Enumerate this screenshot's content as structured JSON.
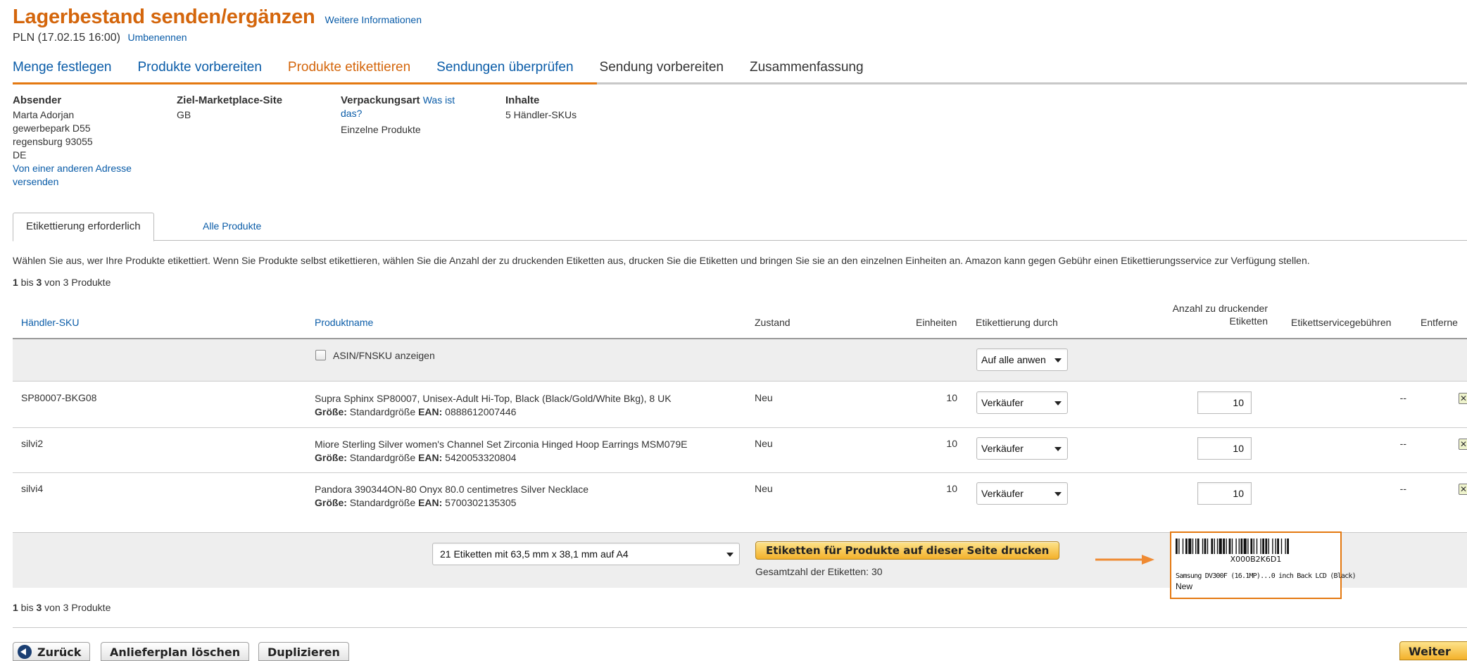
{
  "header": {
    "title": "Lagerbestand senden/ergänzen",
    "more_info": "Weitere Informationen",
    "plan_name": "PLN (17.02.15 16:00)",
    "rename": "Umbenennen"
  },
  "steps": [
    {
      "label": "Menge festlegen",
      "state": "done"
    },
    {
      "label": "Produkte vorbereiten",
      "state": "done"
    },
    {
      "label": "Produkte etikettieren",
      "state": "active"
    },
    {
      "label": "Sendungen überprüfen",
      "state": "done"
    },
    {
      "label": "Sendung vorbereiten",
      "state": "future"
    },
    {
      "label": "Zusammenfassung",
      "state": "future"
    }
  ],
  "shipment_info": {
    "sender_header": "Absender",
    "sender_lines": [
      "Marta Adorjan",
      "gewerbepark D55",
      "regensburg 93055",
      "DE"
    ],
    "sender_link_1": "Von einer anderen Adresse",
    "sender_link_2": "versenden",
    "marketplace_header": "Ziel-Marketplace-Site",
    "marketplace_value": "GB",
    "packaging_header": "Verpackungsart",
    "packaging_link_1": "Was ist",
    "packaging_link_2": "das?",
    "packaging_value": "Einzelne Produkte",
    "contents_header": "Inhalte",
    "contents_value": "5 Händler-SKUs"
  },
  "subtabs": {
    "required": "Etikettierung erforderlich",
    "all": "Alle Produkte"
  },
  "description": "Wählen Sie aus, wer Ihre Produkte etikettiert. Wenn Sie Produkte selbst etikettieren, wählen Sie die Anzahl der zu druckenden Etiketten aus, drucken Sie die Etiketten und bringen Sie sie an den einzelnen Einheiten an. Amazon kann gegen Gebühr einen Etikettierungsservice zur Verfügung stellen.",
  "range": {
    "from": "1",
    "bis": " bis ",
    "to": "3",
    "von": " von ",
    "total": "3",
    "suffix": " Produkte"
  },
  "table": {
    "headers": {
      "sku": "Händler-SKU",
      "name": "Produktname",
      "condition": "Zustand",
      "units": "Einheiten",
      "labeled_by": "Etikettierung durch",
      "labels_line1": "Anzahl zu druckender",
      "labels_line2": "Etiketten",
      "fees": "Etikettservicegebühren",
      "remove": "Entferne"
    },
    "filter": {
      "show_asin": "ASIN/FNSKU anzeigen",
      "apply_all": "Auf alle anwen"
    },
    "rows": [
      {
        "sku": "SP80007-BKG08",
        "name": "Supra Sphinx SP80007, Unisex-Adult Hi-Top, Black (Black/Gold/White Bkg), 8 UK",
        "size_label": "Größe:",
        "size": " Standardgröße ",
        "ean_label": "EAN:",
        "ean": " 0888612007446",
        "condition": "Neu",
        "units": "10",
        "labeled_by": "Verkäufer",
        "labels": "10",
        "fees": "--"
      },
      {
        "sku": "silvi2",
        "name": "Miore Sterling Silver women's Channel Set Zirconia Hinged Hoop Earrings MSM079E",
        "size_label": "Größe:",
        "size": " Standardgröße ",
        "ean_label": "EAN:",
        "ean": " 5420053320804",
        "condition": "Neu",
        "units": "10",
        "labeled_by": "Verkäufer",
        "labels": "10",
        "fees": "--"
      },
      {
        "sku": "silvi4",
        "name": "Pandora 390344ON-80 Onyx 80.0 centimetres Silver Necklace",
        "size_label": "Größe:",
        "size": " Standardgröße ",
        "ean_label": "EAN:",
        "ean": " 5700302135305",
        "condition": "Neu",
        "units": "10",
        "labeled_by": "Verkäufer",
        "labels": "10",
        "fees": "--"
      }
    ]
  },
  "print_bar": {
    "paper_format": "21 Etiketten mit 63,5 mm x 38,1 mm auf A4",
    "print_button": "Etiketten für Produkte auf dieser Seite drucken",
    "total_labels": "Gesamtzahl der Etiketten: 30"
  },
  "label_preview": {
    "code": "X000B2K6D1",
    "product": "Samsung DV300F (16.1MP)...0 inch Back LCD (Black)",
    "condition": "New"
  },
  "footer": {
    "back": "Zurück",
    "delete_plan": "Anlieferplan löschen",
    "duplicate": "Duplizieren",
    "next": "Weiter"
  },
  "colors": {
    "title_orange": "#d4660c",
    "link_blue": "#0a5ca8",
    "step_bar_orange": "#e47911",
    "button_yellow": "#f3b12b"
  }
}
